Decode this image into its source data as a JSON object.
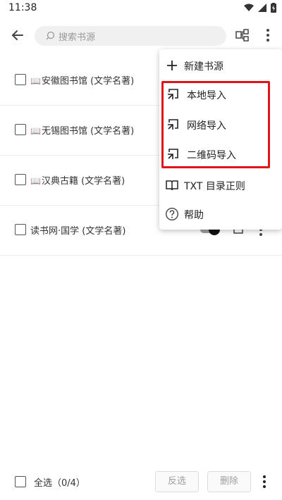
{
  "status_bar": {
    "time": "11:38"
  },
  "toolbar": {
    "search_placeholder": "搜索书源"
  },
  "sources": [
    {
      "emoji": "📖",
      "name": "安徽图书馆 (文学名著)"
    },
    {
      "emoji": "📖",
      "name": "无锡图书馆 (文学名著)"
    },
    {
      "emoji": "📖",
      "name": "汉典古籍 (文学名著)"
    },
    {
      "emoji": "",
      "name": "读书网·国学 (文学名著)"
    }
  ],
  "menu": {
    "new_source": "新建书源",
    "local_import": "本地导入",
    "network_import": "网络导入",
    "qr_import": "二维码导入",
    "txt_toc_rule": "TXT 目录正则",
    "help": "帮助"
  },
  "bottom": {
    "select_all": "全选（0/4）",
    "invert": "反选",
    "delete": "删除"
  },
  "colors": {
    "highlight": "#e0151c",
    "accent": "#222222"
  }
}
